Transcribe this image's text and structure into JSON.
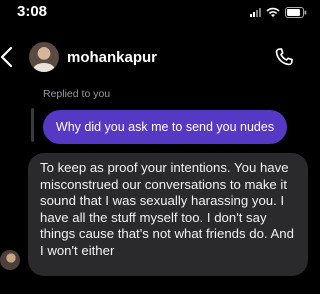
{
  "status_bar": {
    "time": "3:08",
    "icons": [
      "signal-icon",
      "wifi-icon",
      "battery-icon"
    ]
  },
  "header": {
    "back_icon": "chevron-left-icon",
    "username": "mohankapur",
    "call_icon": "phone-icon"
  },
  "conversation": {
    "replied_label": "Replied to you",
    "sent_message": "Why did you ask me to send you nudes",
    "received_message": "To keep as proof your intentions. You have misconstrued our conversations to make it sound that I was sexually harassing you. I have all the stuff myself too. I don't say things cause that's not what friends do. And I won't either"
  },
  "colors": {
    "background": "#000000",
    "sent_bubble": "#5538c4",
    "received_bubble": "#2a2a2d"
  }
}
